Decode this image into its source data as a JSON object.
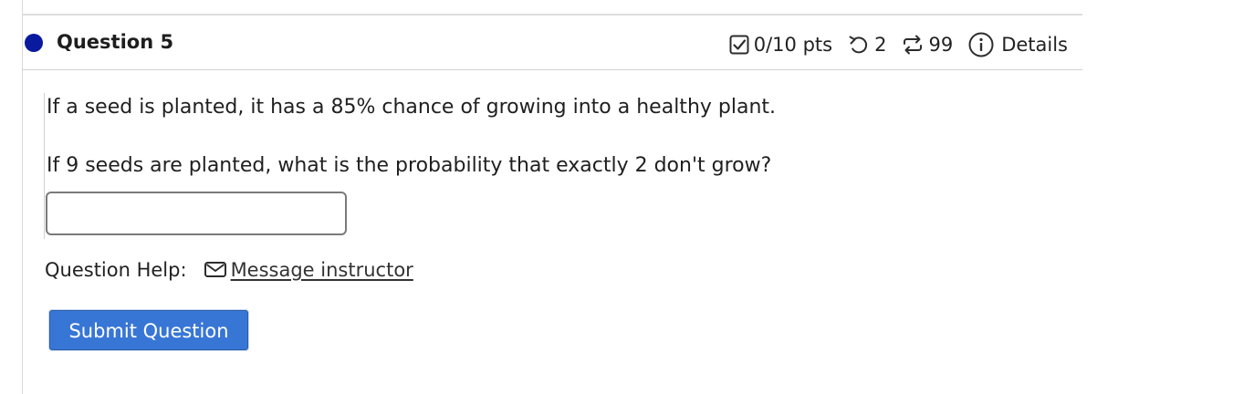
{
  "question": {
    "title": "Question 5",
    "marker_color": "#0a1a9e"
  },
  "meta": {
    "score": "0/10 pts",
    "retries": "2",
    "attempts": "99",
    "details_label": "Details"
  },
  "content": {
    "line1": "If a seed is planted, it has a 85% chance of growing into a healthy plant.",
    "line2": "If 9 seeds are planted, what is the probability that exactly 2 don't grow?",
    "answer_value": ""
  },
  "help": {
    "label": "Question Help:",
    "link_text": "Message instructor"
  },
  "submit": {
    "label": "Submit Question",
    "color": "#3876d6"
  },
  "icons": {
    "score": "checkbox-icon",
    "retries": "retry-icon",
    "attempts": "repeat-icon",
    "details": "info-icon",
    "help": "mail-icon"
  }
}
